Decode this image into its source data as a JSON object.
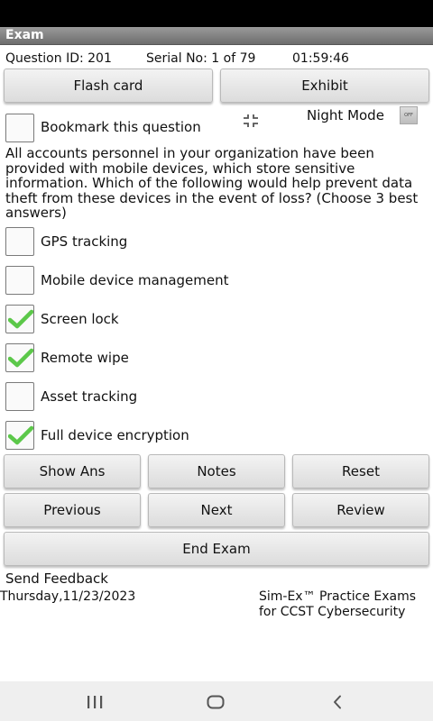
{
  "title_bar": {
    "title": "Exam"
  },
  "info": {
    "question_id": "Question ID: 201",
    "serial": "Serial No: 1 of 79",
    "timer": "01:59:46"
  },
  "top_buttons": {
    "flash_card": "Flash card",
    "exhibit": "Exhibit"
  },
  "bookmark": {
    "label": "Bookmark this question",
    "checked": false
  },
  "night_mode": {
    "label": "Night Mode",
    "toggle_text": "OFF"
  },
  "question": {
    "text": "All accounts personnel in your organization have been provided with mobile devices, which store sensitive information. Which of the following would help prevent data theft from these devices in the event of loss? (Choose 3 best answers)"
  },
  "options": [
    {
      "label": "GPS tracking",
      "checked": false
    },
    {
      "label": "Mobile device management",
      "checked": false
    },
    {
      "label": "Screen lock",
      "checked": true
    },
    {
      "label": "Remote wipe",
      "checked": true
    },
    {
      "label": "Asset tracking",
      "checked": false
    },
    {
      "label": "Full device encryption",
      "checked": true
    }
  ],
  "action_buttons": {
    "show_ans": "Show Ans",
    "notes": "Notes",
    "reset": "Reset",
    "previous": "Previous",
    "next": "Next",
    "review": "Review",
    "end_exam": "End Exam"
  },
  "footer": {
    "send_feedback": "Send Feedback",
    "date": "Thursday,11/23/2023",
    "brand_line1": "Sim-Ex™ Practice Exams",
    "brand_line2": "for CCST Cybersecurity"
  },
  "colors": {
    "check_green": "#5cc84a",
    "title_bar": "#7d7d7d"
  }
}
